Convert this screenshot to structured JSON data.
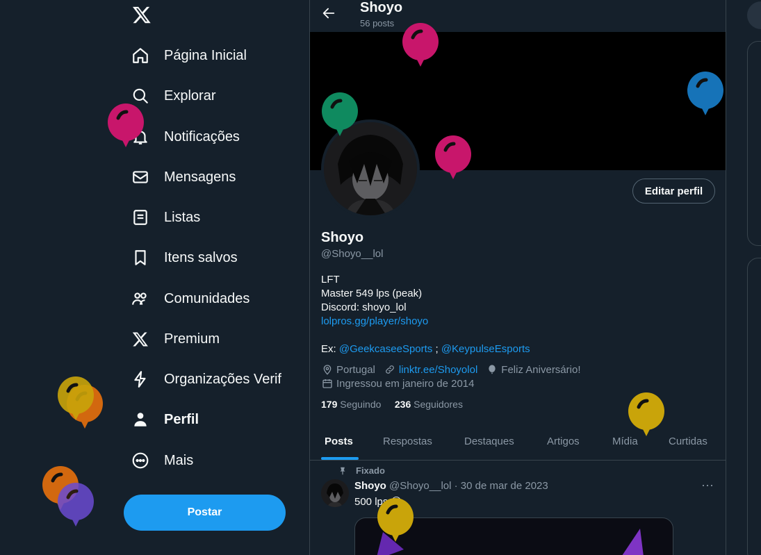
{
  "nav": {
    "items": [
      {
        "label": "Página Inicial"
      },
      {
        "label": "Explorar"
      },
      {
        "label": "Notificações"
      },
      {
        "label": "Mensagens"
      },
      {
        "label": "Listas"
      },
      {
        "label": "Itens salvos"
      },
      {
        "label": "Comunidades"
      },
      {
        "label": "Premium"
      },
      {
        "label": "Organizações Verif"
      },
      {
        "label": "Perfil"
      },
      {
        "label": "Mais"
      }
    ],
    "post_label": "Postar"
  },
  "header": {
    "name": "Shoyo",
    "post_count": "56 posts"
  },
  "profile": {
    "edit_label": "Editar perfil",
    "name": "Shoyo",
    "handle": "@Shoyo__lol",
    "bio": {
      "line1": "LFT",
      "line2": "Master 549 lps (peak)",
      "line3": "Discord: shoyo_lol",
      "link": "lolpros.gg/player/shoyo",
      "ex_prefix": "Ex: ",
      "ex_link1": "@GeekcaseeSports",
      "ex_sep": " ; ",
      "ex_link2": "@KeypulseEsports"
    },
    "location": "Portugal",
    "website": "linktr.ee/Shoyolol",
    "birthday": "Feliz Aniversário!",
    "joined": "Ingressou em janeiro de 2014",
    "following_count": "179",
    "following_label": "Seguindo",
    "followers_count": "236",
    "followers_label": "Seguidores"
  },
  "tabs": [
    {
      "label": "Posts"
    },
    {
      "label": "Respostas"
    },
    {
      "label": "Destaques"
    },
    {
      "label": "Artigos"
    },
    {
      "label": "Mídia"
    },
    {
      "label": "Curtidas"
    }
  ],
  "pinned_tweet": {
    "pinned_label": "Fixado",
    "author": "Shoyo",
    "handle_date": "@Shoyo__lol · 30 de mar de 2023",
    "text": "500 lps 😎",
    "more": "···"
  },
  "colors": {
    "background": "#15202b",
    "accent": "#1d9bf0",
    "muted": "#8b98a5",
    "border": "#38444d",
    "balloon_magenta": "#c8166b",
    "balloon_green": "#0f8a5f",
    "balloon_blue": "#1673b8",
    "balloon_gold": "#c9a40a",
    "balloon_orange": "#d2680f",
    "balloon_purple": "#6a4bd1"
  },
  "icons": [
    "x-logo-icon",
    "home-icon",
    "search-icon",
    "bell-icon",
    "envelope-icon",
    "list-icon",
    "bookmark-icon",
    "people-icon",
    "x-premium-icon",
    "lightning-icon",
    "person-icon",
    "more-circle-icon",
    "back-arrow-icon",
    "location-icon",
    "link-icon",
    "balloon-icon",
    "calendar-icon",
    "pin-icon"
  ]
}
